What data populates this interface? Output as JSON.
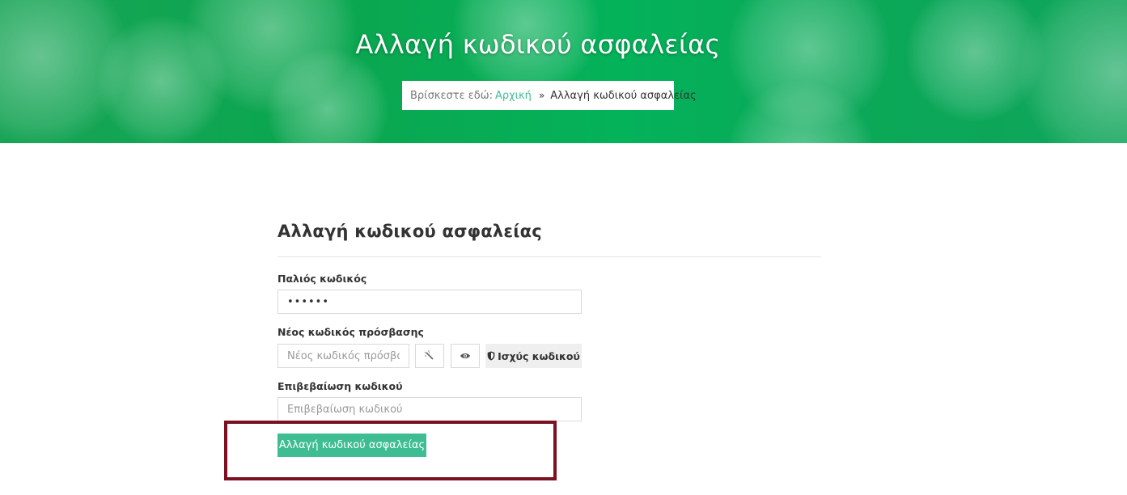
{
  "header": {
    "title": "Αλλαγή κωδικού ασφαλείας",
    "breadcrumb": {
      "prefix": "Βρίσκεστε εδώ:",
      "home": "Αρχική",
      "separator": "»",
      "current": "Αλλαγή κωδικού ασφαλείας"
    }
  },
  "form": {
    "heading": "Αλλαγή κωδικού ασφαλείας",
    "old_password": {
      "label": "Παλιός κωδικός",
      "value": "••••••"
    },
    "new_password": {
      "label": "Νέος κωδικός πρόσβασης",
      "placeholder": "Νέος κωδικός πρόσβασης",
      "generate_icon": "magic-wand-icon",
      "show_icon": "eye-icon",
      "strength_icon": "shield-icon",
      "strength_label": "Ισχύς κωδικού"
    },
    "confirm_password": {
      "label": "Επιβεβαίωση κωδικού",
      "placeholder": "Επιβεβαίωση κωδικού"
    },
    "submit_label": "Αλλαγή κωδικού ασφαλείας"
  },
  "colors": {
    "accent": "#3ebd93",
    "hero_green": "#0aa64f",
    "highlight": "#7a1022"
  }
}
